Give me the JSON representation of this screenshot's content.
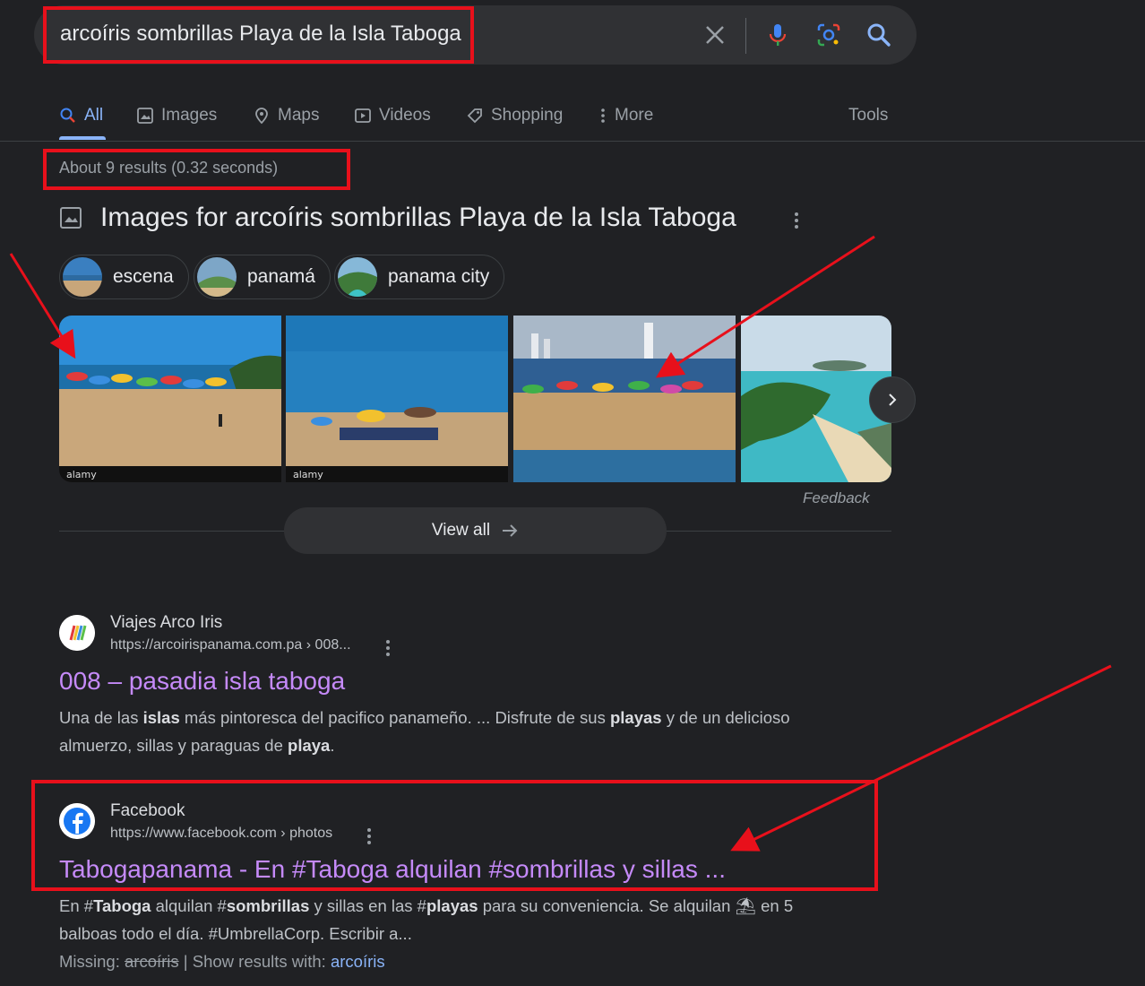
{
  "search": {
    "query": "arcoíris sombrillas Playa de la Isla Taboga"
  },
  "tabs": [
    {
      "label": "All"
    },
    {
      "label": "Images"
    },
    {
      "label": "Maps"
    },
    {
      "label": "Videos"
    },
    {
      "label": "Shopping"
    },
    {
      "label": "More"
    }
  ],
  "tools_label": "Tools",
  "stats": "About 9 results (0.32 seconds)",
  "images_section": {
    "title": "Images for arcoíris sombrillas Playa de la Isla Taboga",
    "chips": [
      {
        "label": "escena"
      },
      {
        "label": "panamá"
      },
      {
        "label": "panama city"
      }
    ],
    "photo_watermark": "alamy",
    "feedback": "Feedback",
    "view_all": "View all"
  },
  "results": [
    {
      "site": "Viajes Arco Iris",
      "url": "https://arcoirispanama.com.pa › 008...",
      "title": "008 – pasadia isla taboga",
      "snippet": [
        {
          "t": "Una de las "
        },
        {
          "b": "islas"
        },
        {
          "t": " más pintoresca del pacifico panameño. ... Disfrute de sus "
        },
        {
          "b": "playas"
        },
        {
          "t": " y de un delicioso almuerzo, sillas y paraguas de "
        },
        {
          "b": "playa"
        },
        {
          "t": "."
        }
      ]
    },
    {
      "site": "Facebook",
      "url": "https://www.facebook.com › photos",
      "title": "Tabogapanama - En #Taboga alquilan #sombrillas y sillas ...",
      "snippet": [
        {
          "t": "En #"
        },
        {
          "b": "Taboga"
        },
        {
          "t": " alquilan #"
        },
        {
          "b": "sombrillas"
        },
        {
          "t": " y sillas en las #"
        },
        {
          "b": "playas"
        },
        {
          "t": " para su conveniencia. Se alquilan ⛱ en 5 balboas todo el día. #UmbrellaCorp. Escribir a..."
        }
      ],
      "missing_label": "Missing:",
      "missing_term": "arcoíris",
      "show_with_label": "| Show results with:",
      "show_with_term": "arcoíris"
    }
  ],
  "colors": {
    "background": "#202124",
    "link_visited": "#c58af9",
    "accent": "#8ab4f8",
    "annotation_red": "#e8101b"
  }
}
